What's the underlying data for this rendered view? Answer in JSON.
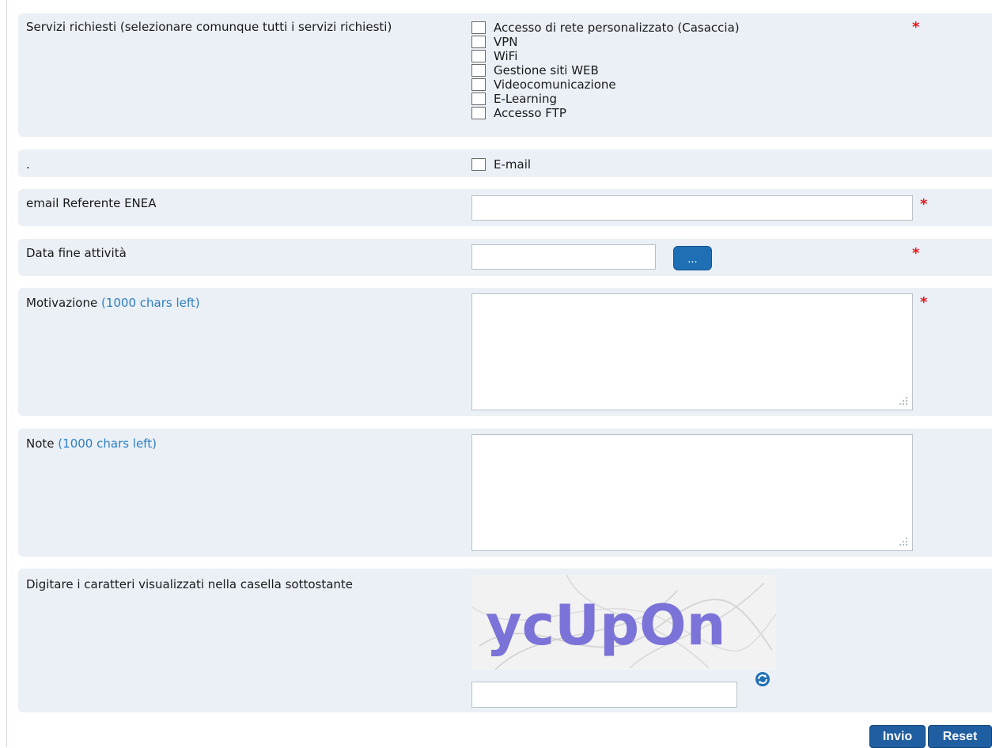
{
  "services": {
    "label": "Servizi richiesti (selezionare comunque tutti i servizi richiesti)",
    "required_mark": "*",
    "options": [
      {
        "label": "Accesso di rete personalizzato (Casaccia)",
        "checked": false
      },
      {
        "label": "VPN",
        "checked": false
      },
      {
        "label": "WiFi",
        "checked": false
      },
      {
        "label": "Gestione siti WEB",
        "checked": false
      },
      {
        "label": "Videocomunicazione",
        "checked": false
      },
      {
        "label": "E-Learning",
        "checked": false
      },
      {
        "label": "Accesso FTP",
        "checked": false
      }
    ]
  },
  "email_service": {
    "label": ".",
    "option": "E-mail"
  },
  "referent": {
    "label": "email Referente ENEA",
    "value": "",
    "required_mark": "*"
  },
  "end_date": {
    "label": "Data fine attività",
    "value": "",
    "button_label": "...",
    "required_mark": "*"
  },
  "motivation": {
    "label": "Motivazione",
    "chars_left": "(1000 chars left)",
    "value": "",
    "required_mark": "*"
  },
  "notes": {
    "label": "Note",
    "chars_left": "(1000 chars left)",
    "value": ""
  },
  "captcha": {
    "label": "Digitare i caratteri visualizzati nella casella sottostante",
    "image_text": "ycUpOn",
    "value": ""
  },
  "actions": {
    "submit_label": "Invio",
    "reset_label": "Reset"
  },
  "colors": {
    "row_bg": "#eaf0f6",
    "required": "#e0181f",
    "hint": "#2d7fc1",
    "button": "#1f5ea0"
  }
}
